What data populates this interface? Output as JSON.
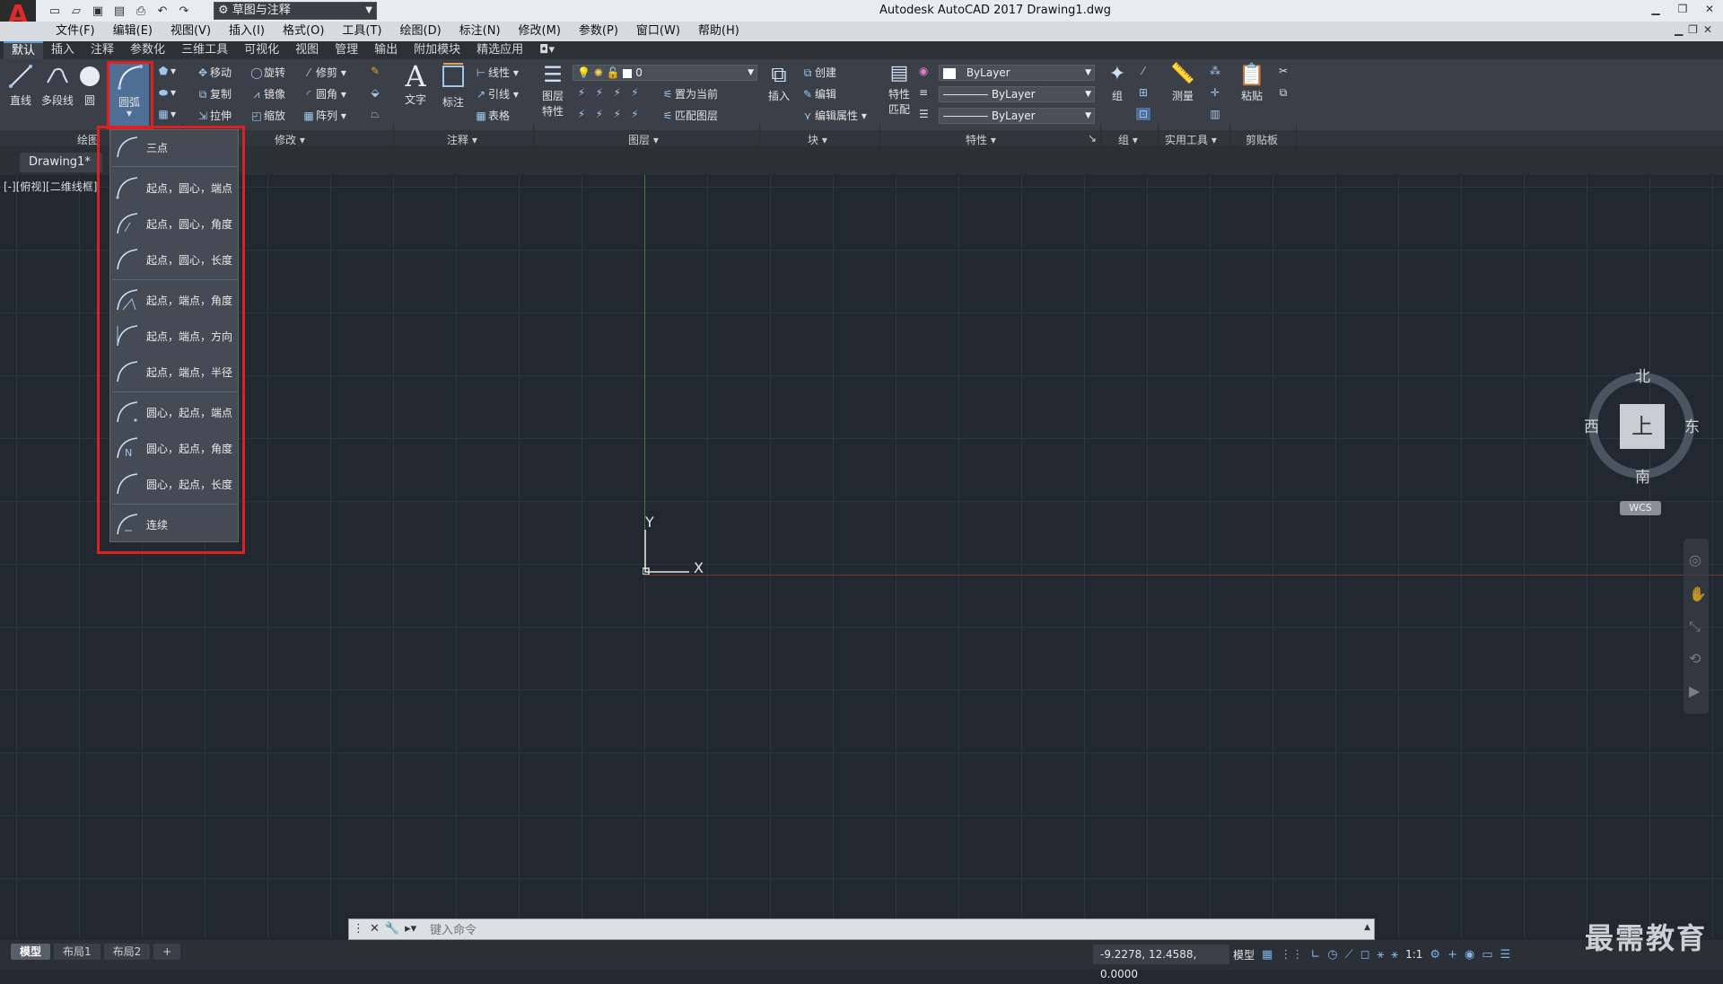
{
  "titlebar": {
    "workspace": "草图与注释",
    "title": "Autodesk AutoCAD 2017    Drawing1.dwg"
  },
  "menubar": {
    "items": [
      "文件(F)",
      "编辑(E)",
      "视图(V)",
      "插入(I)",
      "格式(O)",
      "工具(T)",
      "绘图(D)",
      "标注(N)",
      "修改(M)",
      "参数(P)",
      "窗口(W)",
      "帮助(H)"
    ]
  },
  "ribbon": {
    "tabs": [
      "默认",
      "插入",
      "注释",
      "参数化",
      "三维工具",
      "可视化",
      "视图",
      "管理",
      "输出",
      "附加模块",
      "精选应用"
    ],
    "draw": {
      "line": "直线",
      "polyline": "多段线",
      "circle": "圆",
      "arc": "圆弧",
      "panel": "绘图"
    },
    "modify": {
      "move": "移动",
      "rotate": "旋转",
      "trim": "修剪",
      "copy": "复制",
      "mirror": "镜像",
      "fillet": "圆角",
      "stretch": "拉伸",
      "scale": "缩放",
      "array": "阵列",
      "panel": "修改"
    },
    "annotation": {
      "text": "文字",
      "dimension": "标注",
      "linear": "线性",
      "leader": "引线",
      "table": "表格",
      "panel": "注释"
    },
    "layers": {
      "layer_props": "图层\n特性",
      "layer_props_l1": "图层",
      "layer_props_l2": "特性",
      "current_layer": "0",
      "set_current": "置为当前",
      "match_layer": "匹配图层",
      "panel": "图层"
    },
    "block": {
      "insert": "插入",
      "create": "创建",
      "edit": "编辑",
      "edit_attr": "编辑属性",
      "panel": "块"
    },
    "properties": {
      "match_l1": "特性",
      "match_l2": "匹配",
      "color": "ByLayer",
      "linetype": "ByLayer",
      "lineweight": "ByLayer",
      "panel": "特性"
    },
    "groups": {
      "group": "组",
      "panel": "组"
    },
    "utilities": {
      "measure": "测量",
      "panel": "实用工具"
    },
    "clipboard": {
      "paste": "粘贴",
      "panel": "剪贴板"
    }
  },
  "file_tab": "Drawing1*",
  "viewport_label": "[-][俯视][二维线框]",
  "ucs": {
    "x": "X",
    "y": "Y"
  },
  "viewcube": {
    "north": "北",
    "south": "南",
    "east": "东",
    "west": "西",
    "face": "上",
    "wcs": "WCS"
  },
  "arc_menu": {
    "items": [
      "三点",
      "起点，圆心，端点",
      "起点，圆心，角度",
      "起点，圆心，长度",
      "起点，端点，角度",
      "起点，端点，方向",
      "起点，端点，半径",
      "圆心，起点，端点",
      "圆心，起点，角度",
      "圆心，起点，长度",
      "连续"
    ]
  },
  "command": {
    "placeholder": "键入命令"
  },
  "statusbar": {
    "layouts": [
      "模型",
      "布局1",
      "布局2"
    ],
    "coords": "-9.2278, 12.4588, 0.0000",
    "model": "模型",
    "scale": "1:1"
  },
  "watermark": "最需教育"
}
